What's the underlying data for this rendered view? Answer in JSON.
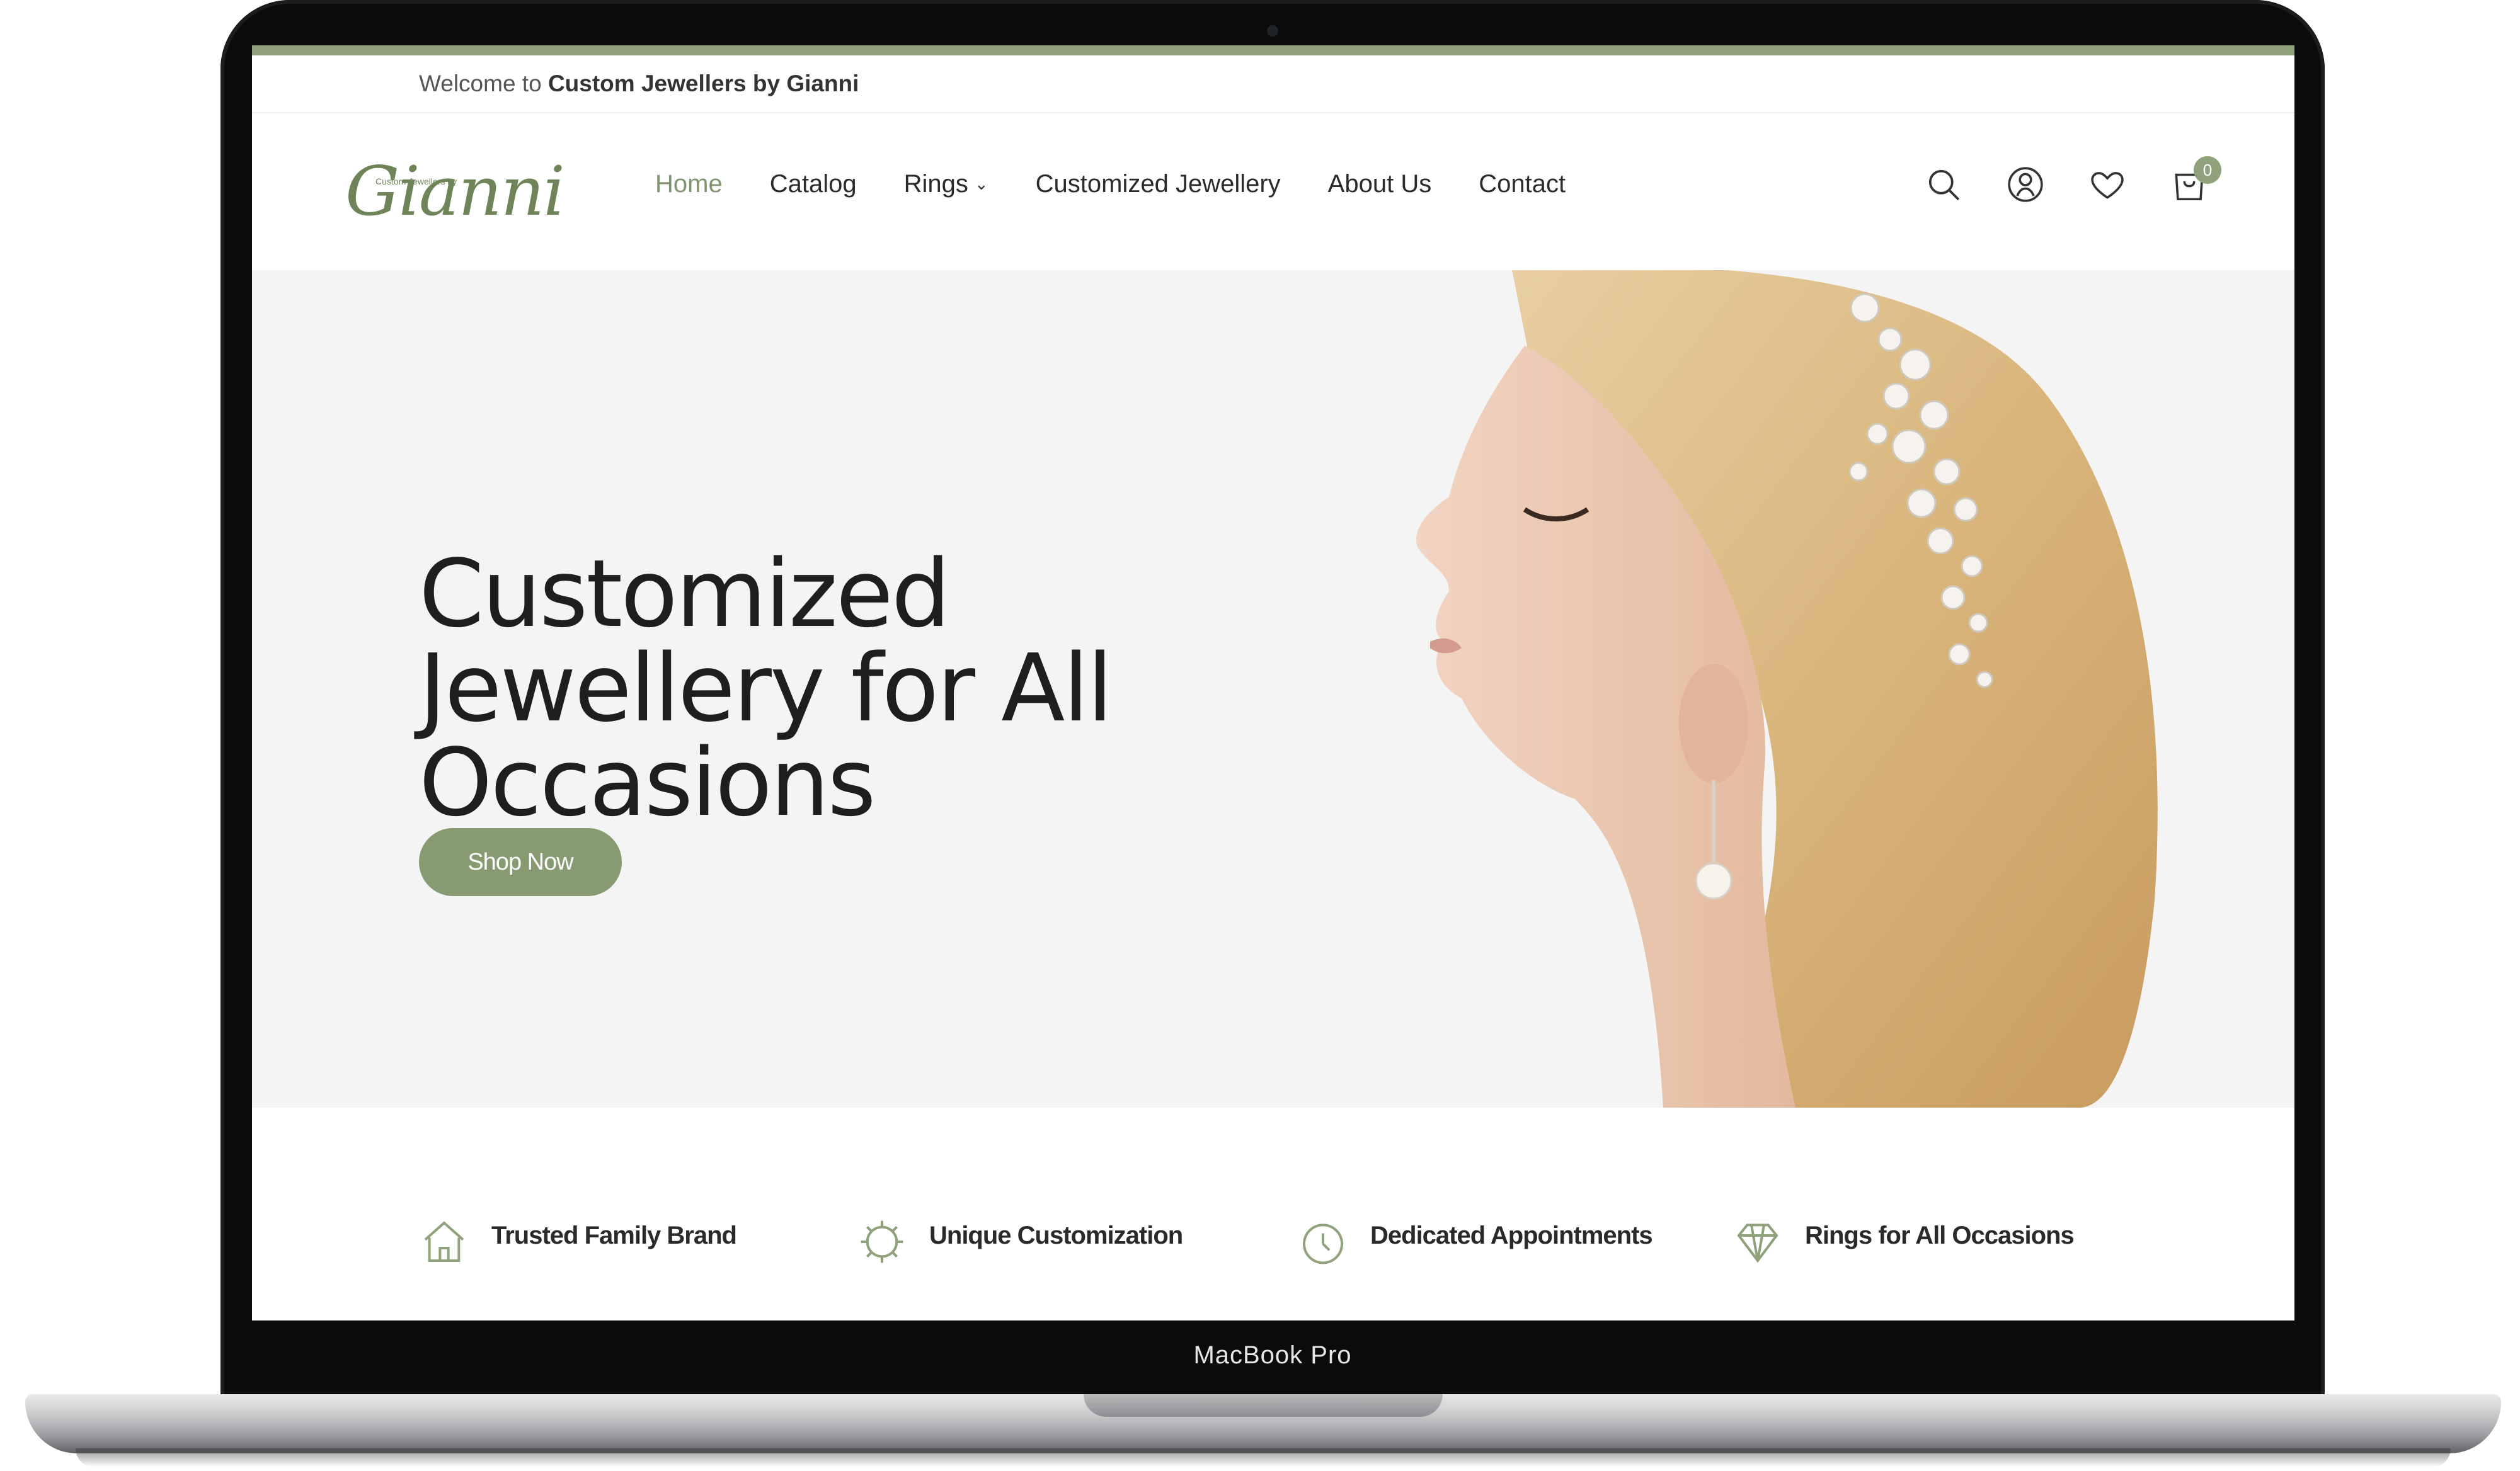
{
  "device": {
    "label": "MacBook Pro"
  },
  "topbar": {
    "welcome_prefix": "Welcome to ",
    "brand": "Custom Jewellers by Gianni"
  },
  "logo": {
    "word": "Gianni",
    "tagline": "Custom Jewellers by"
  },
  "nav": {
    "items": [
      {
        "label": "Home"
      },
      {
        "label": "Catalog"
      },
      {
        "label": "Rings"
      },
      {
        "label": "Customized Jewellery"
      },
      {
        "label": "About Us"
      },
      {
        "label": "Contact"
      }
    ]
  },
  "header_icons": {
    "search": "search-icon",
    "account": "user-icon",
    "wishlist": "heart-icon",
    "cart": "cart-icon",
    "cart_count": "0"
  },
  "hero": {
    "title_line1": "Customized",
    "title_line2": "Jewellery for All",
    "title_line3": "Occasions",
    "cta": "Shop Now"
  },
  "features": [
    {
      "label": "Trusted Family Brand",
      "icon": "house-icon"
    },
    {
      "label": "Unique Customization",
      "icon": "gear-icon"
    },
    {
      "label": "Dedicated Appointments",
      "icon": "clock-icon"
    },
    {
      "label": "Rings for All Occasions",
      "icon": "diamond-icon"
    }
  ],
  "colors": {
    "accent": "#8fa27c",
    "cta": "#879b72",
    "hero_bg": "#f4f4f4"
  }
}
